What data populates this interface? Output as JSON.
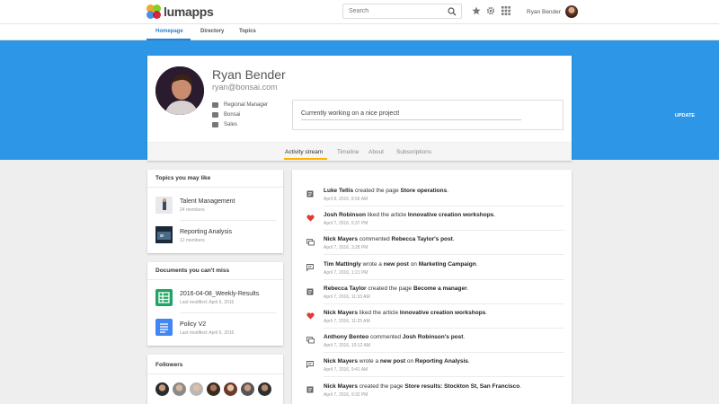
{
  "app": {
    "logo_text": "lumapps"
  },
  "search": {
    "placeholder": "Search"
  },
  "top_user": {
    "name": "Ryan Bender"
  },
  "nav": {
    "items": [
      "Homepage",
      "Directory",
      "Topics"
    ],
    "active": "Homepage"
  },
  "profile": {
    "name": "Ryan Bender",
    "email": "ryan@bonsai.com",
    "role": "Regional Manager",
    "company": "Bonsai",
    "department": "Sales",
    "status_text": "Currently working on a nice project!",
    "update_label": "UPDATE",
    "tabs": [
      "Activity stream",
      "Timeline",
      "About",
      "Subscriptions"
    ],
    "active_tab": "Activity stream"
  },
  "topics": {
    "title": "Topics you may like",
    "items": [
      {
        "name": "Talent Management",
        "members": "24 members"
      },
      {
        "name": "Reporting Analysis",
        "members": "12 members"
      }
    ]
  },
  "documents": {
    "title": "Documents you can't miss",
    "items": [
      {
        "name": "2016-04-08_Weekly-Results",
        "modified": "Last modified: April 6, 2016",
        "type": "sheet"
      },
      {
        "name": "Policy V2",
        "modified": "Last modified: April 6, 2016",
        "type": "doc"
      }
    ]
  },
  "followers": {
    "title": "Followers",
    "count_shown": 7
  },
  "feed": [
    {
      "icon": "page",
      "actor": "Luke Tellis",
      "verb": " created the page ",
      "object": "Store operations",
      "tail": ".",
      "time": "April 8, 2016, 8:56 AM"
    },
    {
      "icon": "heart",
      "actor": "Josh Robinson",
      "verb": " liked the article ",
      "object": "Innovative creation workshops",
      "tail": ".",
      "time": "April 7, 2016, 5:37 PM"
    },
    {
      "icon": "comment",
      "actor": "Nick Mayers",
      "verb": " commented ",
      "object": "Rebecca Taylor's post",
      "tail": ".",
      "time": "April 7, 2016, 3:28 PM"
    },
    {
      "icon": "post",
      "actor": "Tim Mattingly",
      "verb": " wrote a ",
      "object": "new post",
      "tail": " on ",
      "object2": "Marketing Campaign",
      "tail2": ".",
      "time": "April 7, 2016, 1:21 PM"
    },
    {
      "icon": "page",
      "actor": "Rebecca Taylor",
      "verb": " created the page ",
      "object": "Become a manager",
      "tail": ".",
      "time": "April 7, 2016, 11:33 AM"
    },
    {
      "icon": "heart",
      "actor": "Nick Mayers",
      "verb": " liked the article ",
      "object": "Innovative creation workshops",
      "tail": ".",
      "time": "April 7, 2016, 11:25 AM"
    },
    {
      "icon": "comment",
      "actor": "Anthony Benteo",
      "verb": " commented ",
      "object": "Josh Robinson's post",
      "tail": ".",
      "time": "April 7, 2016, 10:12 AM"
    },
    {
      "icon": "post",
      "actor": "Nick Mayers",
      "verb": " wrote a ",
      "object": "new post",
      "tail": " on ",
      "object2": "Reporting Analysis",
      "tail2": ".",
      "time": "April 7, 2016, 9:41 AM"
    },
    {
      "icon": "page",
      "actor": "Nick Mayers",
      "verb": " created the page ",
      "object": "Store results: Stockton St, San Francisco",
      "tail": ".",
      "time": "April 7, 2016, 9:32 PM"
    }
  ],
  "colors": {
    "accent": "#2e96e6",
    "nav_active": "#2f7fc8",
    "tab_underline": "#ffb300",
    "heart": "#e53935"
  }
}
